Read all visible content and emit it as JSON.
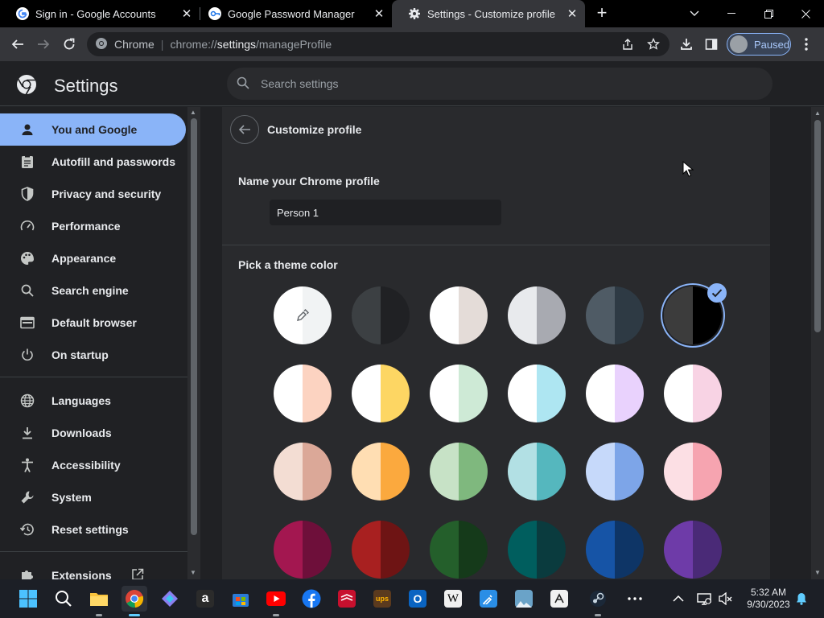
{
  "tabs": [
    {
      "title": "Sign in - Google Accounts",
      "favicon": "google-g-icon",
      "active": false
    },
    {
      "title": "Google Password Manager",
      "favicon": "password-manager-icon",
      "active": false
    },
    {
      "title": "Settings - Customize profile",
      "favicon": "gear-icon",
      "active": true
    }
  ],
  "toolbar": {
    "site_label": "Chrome",
    "url_prefix": "chrome://",
    "url_host": "settings",
    "url_path": "/manageProfile",
    "profile_status": "Paused"
  },
  "settings": {
    "title": "Settings",
    "search_placeholder": "Search settings"
  },
  "sidebar": {
    "items": [
      {
        "label": "You and Google",
        "icon": "person-icon",
        "active": true
      },
      {
        "label": "Autofill and passwords",
        "icon": "clipboard-icon"
      },
      {
        "label": "Privacy and security",
        "icon": "shield-icon"
      },
      {
        "label": "Performance",
        "icon": "speedometer-icon"
      },
      {
        "label": "Appearance",
        "icon": "palette-icon"
      },
      {
        "label": "Search engine",
        "icon": "search-icon"
      },
      {
        "label": "Default browser",
        "icon": "browser-window-icon"
      },
      {
        "label": "On startup",
        "icon": "power-icon"
      },
      {
        "label": "Languages",
        "icon": "globe-icon"
      },
      {
        "label": "Downloads",
        "icon": "download-icon"
      },
      {
        "label": "Accessibility",
        "icon": "accessibility-icon"
      },
      {
        "label": "System",
        "icon": "wrench-icon"
      },
      {
        "label": "Reset settings",
        "icon": "history-icon"
      },
      {
        "label": "Extensions",
        "icon": "puzzle-icon"
      }
    ]
  },
  "profile": {
    "page_title": "Customize profile",
    "name_label": "Name your Chrome profile",
    "name_value": "Person 1",
    "theme_label": "Pick a theme color"
  },
  "theme_colors": [
    {
      "left": "#ffffff",
      "right": "#f1f3f4",
      "type": "picker"
    },
    {
      "left": "#3c4043",
      "right": "#202124"
    },
    {
      "left": "#ffffff",
      "right": "#e4dcd8"
    },
    {
      "left": "#e8eaed",
      "right": "#a8aab1"
    },
    {
      "left": "#4f5b65",
      "right": "#2e3a44"
    },
    {
      "left": "#3c3c3c",
      "right": "#000000",
      "selected": true
    },
    {
      "left": "#ffffff",
      "right": "#fcd3c1"
    },
    {
      "left": "#ffffff",
      "right": "#fdd663"
    },
    {
      "left": "#ffffff",
      "right": "#ceead6"
    },
    {
      "left": "#ffffff",
      "right": "#aee6f2"
    },
    {
      "left": "#ffffff",
      "right": "#e9d2fd"
    },
    {
      "left": "#ffffff",
      "right": "#f8d3e4"
    },
    {
      "left": "#f3ddd3",
      "right": "#dba898"
    },
    {
      "left": "#ffdeb3",
      "right": "#fba93e"
    },
    {
      "left": "#c7e2c6",
      "right": "#7fb87e"
    },
    {
      "left": "#b2e0e4",
      "right": "#55b7be"
    },
    {
      "left": "#c6d9fa",
      "right": "#7da5e8"
    },
    {
      "left": "#fcdfe4",
      "right": "#f6a4b0"
    },
    {
      "left": "#a31750",
      "right": "#6e0f3a"
    },
    {
      "left": "#a82020",
      "right": "#6e1414"
    },
    {
      "left": "#245f2b",
      "right": "#153a1a"
    },
    {
      "left": "#005e5e",
      "right": "#0a3b3e"
    },
    {
      "left": "#1654a6",
      "right": "#0e3566"
    },
    {
      "left": "#6e3ba8",
      "right": "#4a2a77"
    }
  ],
  "taskbar": {
    "time": "5:32 AM",
    "date": "9/30/2023"
  }
}
